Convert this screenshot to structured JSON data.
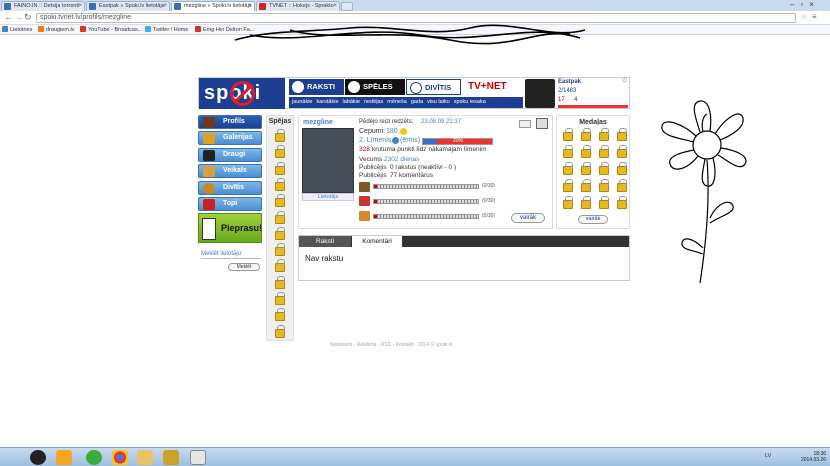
{
  "browser": {
    "tabs": [
      {
        "label": "FAINO.IN :: Detsija torrenti",
        "active": false
      },
      {
        "label": "Eastpak » Spoki.lv lietotājs",
        "active": false
      },
      {
        "label": "mezgline » Spoki.lv lietotājs",
        "active": true
      },
      {
        "label": "TVNET :: Hokejs - Sprakto",
        "active": false
      }
    ],
    "url": "spoki.tvnet.lv/profils/mezgline",
    "bookmarks": [
      "Lietotnes",
      "draugiem.lv",
      "YouTube - Broadcas...",
      "Twitter / Home",
      "Emg Hvr Delton Fa..."
    ]
  },
  "site": {
    "logo_text": "spoki",
    "nav": {
      "raksti": "RAKSTI",
      "speles": "SPĒLES",
      "divitis": "DIVĪTIS",
      "tvnet": "TV+NET"
    },
    "subnav": [
      "jaunākie",
      "karstākie",
      "labākie",
      "nedēļas",
      "mēneša",
      "gada",
      "visu laiku",
      "spoku iesaka"
    ],
    "user": {
      "name": "Eastpak",
      "points": "2/1483",
      "stat1": "17",
      "stat2": "4"
    }
  },
  "sidebar": {
    "items": [
      {
        "label": "Profils",
        "color": "#6b3a1c"
      },
      {
        "label": "Galerijas",
        "color": "#e0a020"
      },
      {
        "label": "Draugi",
        "color": "#222222"
      },
      {
        "label": "Veikals",
        "color": "#d4a040"
      },
      {
        "label": "Divītis",
        "color": "#cc8820"
      },
      {
        "label": "Topi",
        "color": "#c92020"
      }
    ],
    "pieprasu": "Pieprasu!",
    "search_label": "Meklēt lietotāju",
    "search_button": "Meklēt"
  },
  "spejas": {
    "title": "Spējas"
  },
  "profile": {
    "username": "mezgline",
    "user_link": "Lietotājs",
    "last_seen_label": "Pēdējo reizi redzēts:",
    "last_seen": "23.08.09 21:37",
    "cepumi_label": "Cepumi:",
    "cepumi": "180",
    "level": "2. Līmenis",
    "level_name": "(ērms)",
    "progress_label": "20%",
    "progress": 0.2,
    "points_needed": "328",
    "points_text": "krutuma punkti līdz nākamajam līmenim",
    "age_label": "Vecums",
    "age": "2302 dienas",
    "raksti_label": "Publicējis",
    "raksti": "0 rakstus (neaktīvi - 0 )",
    "comments_label": "Publicējis",
    "comments": "77 komentārus",
    "bars": [
      "(0/30)",
      "(0/30)",
      "(0/30)"
    ],
    "more": "vairāk"
  },
  "medals": {
    "title": "Medaļas",
    "more": "vairāk"
  },
  "content_tabs": {
    "raksti": "Raksti",
    "komentari": "Komentāri",
    "empty": "Nav rakstu"
  },
  "footer": "Noteikumi · Reklāma · RSS · Kontakti · 2014 © spoki.lv",
  "taskbar": {
    "lang": "LV",
    "time": "18:36",
    "date": "2014.03.26"
  }
}
